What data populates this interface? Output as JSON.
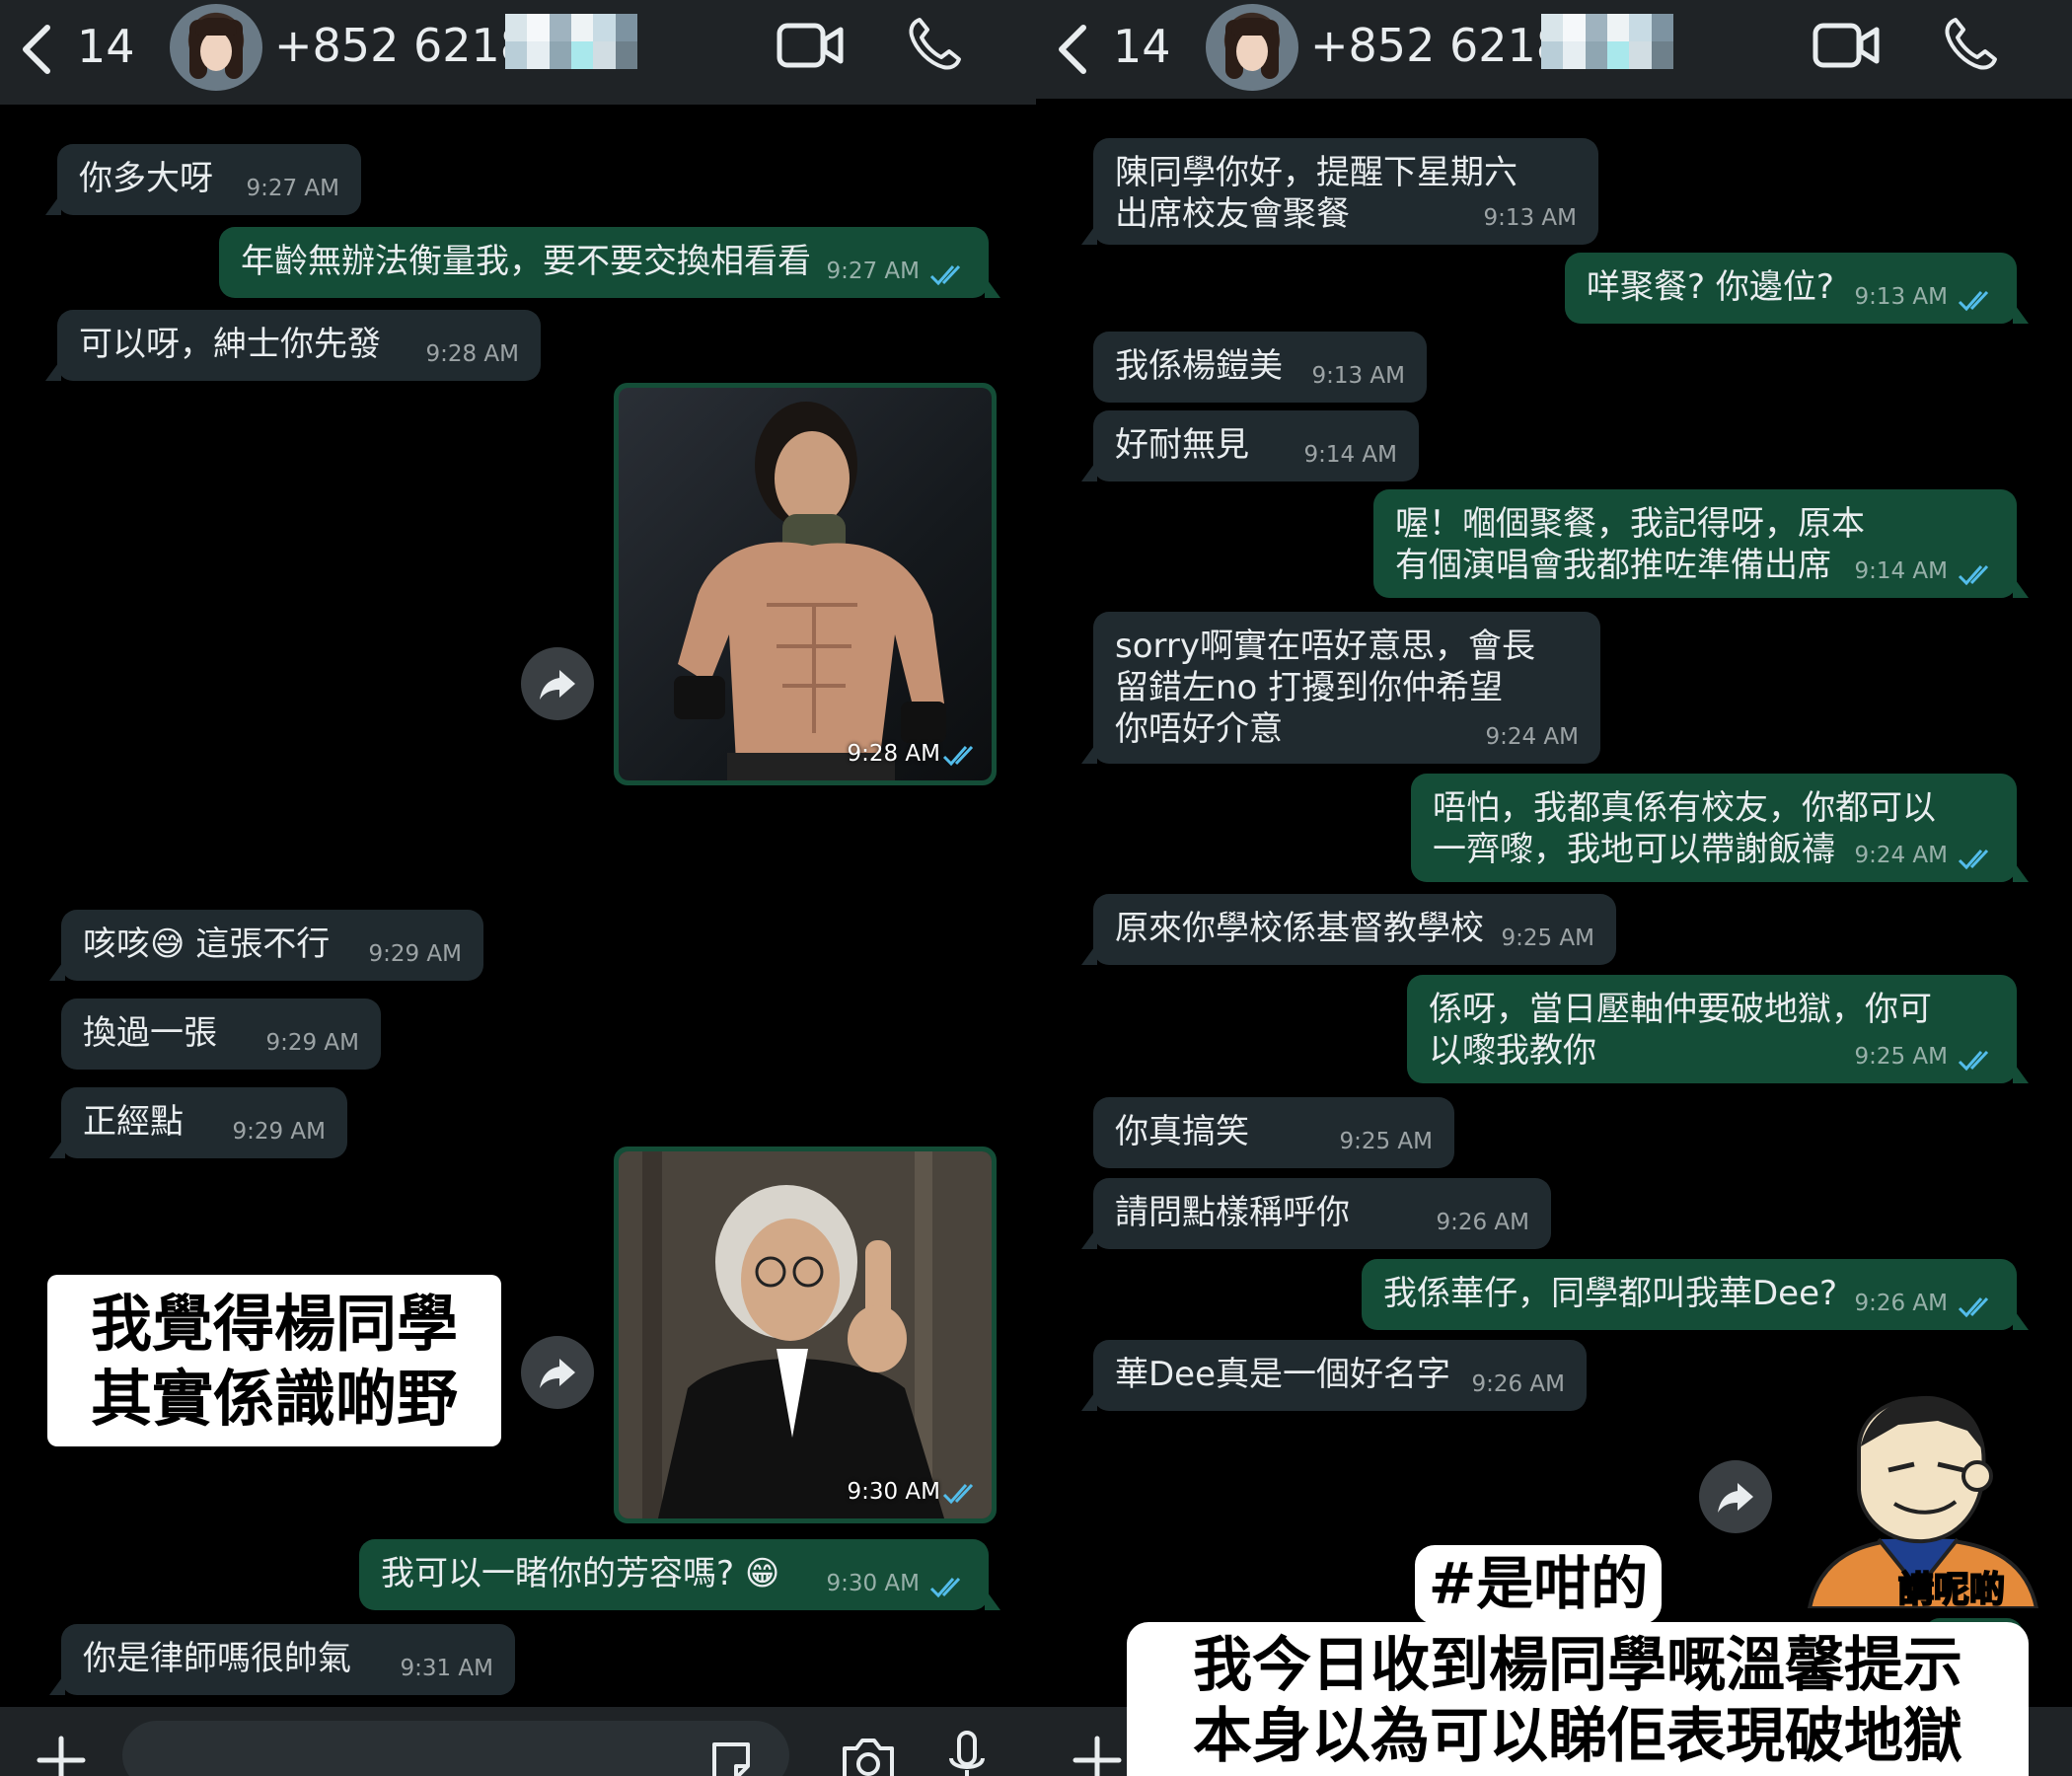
{
  "left": {
    "header": {
      "unread_count": "14",
      "phone": "+852 6218"
    },
    "messages": [
      {
        "text": "你多大呀",
        "time": "9:27 AM"
      },
      {
        "text": "年齡無辦法衡量我，要不要交換相看看",
        "time": "9:27 AM"
      },
      {
        "text": "可以呀，紳士你先發",
        "time": "9:28 AM"
      },
      {
        "time": "9:28 AM"
      },
      {
        "text": "咳咳😅 這張不行",
        "time": "9:29 AM"
      },
      {
        "text": "換過一張",
        "time": "9:29 AM"
      },
      {
        "text": "正經點",
        "time": "9:29 AM"
      },
      {
        "time": "9:30 AM"
      },
      {
        "text": "我可以一睹你的芳容嗎? 😁",
        "time": "9:30 AM"
      },
      {
        "text": "你是律師嗎很帥氣",
        "time": "9:31 AM"
      }
    ],
    "caption": {
      "line1": "我覺得楊同學",
      "line2": "其實係識啲野"
    }
  },
  "right": {
    "header": {
      "unread_count": "14",
      "phone": "+852 6218"
    },
    "messages": [
      {
        "text": "陳同學你好，提醒下星期六\n出席校友會聚餐",
        "time": "9:13 AM"
      },
      {
        "text": "咩聚餐? 你邊位?",
        "time": "9:13 AM"
      },
      {
        "text": "我係楊鎧美",
        "time": "9:13 AM"
      },
      {
        "text": "好耐無見",
        "time": "9:14 AM"
      },
      {
        "text": "喔！嗰個聚餐，我記得呀，原本\n有個演唱會我都推咗準備出席",
        "time": "9:14 AM"
      },
      {
        "text": "sorry啊實在唔好意思，會長\n留錯左no 打擾到你仲希望\n你唔好介意",
        "time": "9:24 AM"
      },
      {
        "text": "唔怕，我都真係有校友，你都可以\n一齊嚟，我地可以帶謝飯禱",
        "time": "9:24 AM"
      },
      {
        "text": "原來你學校係基督教學校",
        "time": "9:25 AM"
      },
      {
        "text": "係呀，當日壓軸仲要破地獄，你可\n以嚟我教你",
        "time": "9:25 AM"
      },
      {
        "text": "你真搞笑",
        "time": "9:25 AM"
      },
      {
        "text": "請問點樣稱呼你",
        "time": "9:26 AM"
      },
      {
        "text": "我係華仔，同學都叫我華Dee?",
        "time": "9:26 AM"
      },
      {
        "text": "華Dee真是一個好名字",
        "time": "9:26 AM"
      }
    ],
    "hashtag": "#是咁的",
    "caption": {
      "line1": "我今日收到楊同學嘅溫馨提示",
      "line2": "本身以為可以睇佢表現破地獄"
    },
    "sticker_text": "講呢啲"
  },
  "colors": {
    "incoming": "#202a2f",
    "outgoing": "#144d37",
    "tick": "#53bdeb",
    "header": "#1f2326"
  }
}
